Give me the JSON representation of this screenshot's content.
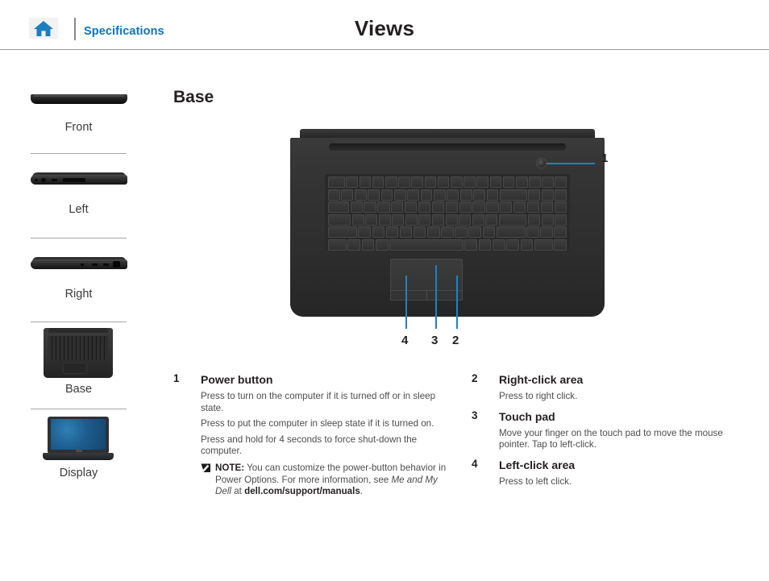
{
  "header": {
    "home_icon": "home-icon",
    "breadcrumb": "Specifications",
    "title": "Views"
  },
  "sidebar": {
    "items": [
      {
        "label": "Front",
        "thumb": "laptop-front-view"
      },
      {
        "label": "Left",
        "thumb": "laptop-left-view"
      },
      {
        "label": "Right",
        "thumb": "laptop-right-view"
      },
      {
        "label": "Base",
        "thumb": "laptop-base-view"
      },
      {
        "label": "Display",
        "thumb": "laptop-display-view"
      }
    ]
  },
  "main": {
    "section_title": "Base",
    "figure": {
      "alt": "laptop-base-top-view",
      "callout_labels": [
        "1",
        "4",
        "3",
        "2"
      ]
    },
    "left_column": [
      {
        "num": "1",
        "title": "Power button",
        "paragraphs": [
          "Press to turn on the computer if it is turned off or in sleep state.",
          "Press to put the computer in sleep state if it is turned on.",
          "Press and hold for 4 seconds to force shut-down the computer."
        ],
        "note": {
          "icon": "note-pencil-icon",
          "label": "NOTE:",
          "text_before": " You can customize the power-button behavior in Power Options. For more information, see ",
          "italic": "Me and My Dell",
          "text_middle": " at ",
          "bold_link": "dell.com/support/manuals",
          "text_after": "."
        }
      }
    ],
    "right_column": [
      {
        "num": "2",
        "title": "Right-click area",
        "paragraphs": [
          "Press to right click."
        ]
      },
      {
        "num": "3",
        "title": "Touch pad",
        "paragraphs": [
          "Move your finger on the touch pad to move the mouse pointer. Tap to left-click."
        ]
      },
      {
        "num": "4",
        "title": "Left-click area",
        "paragraphs": [
          "Press to left click."
        ]
      }
    ]
  },
  "colors": {
    "accent_blue": "#0b74bc",
    "leader_line_blue": "#1b84c3",
    "text_dark": "#231f20",
    "text_body": "#4d4d4d",
    "rule_gray": "#9b9b9b"
  }
}
